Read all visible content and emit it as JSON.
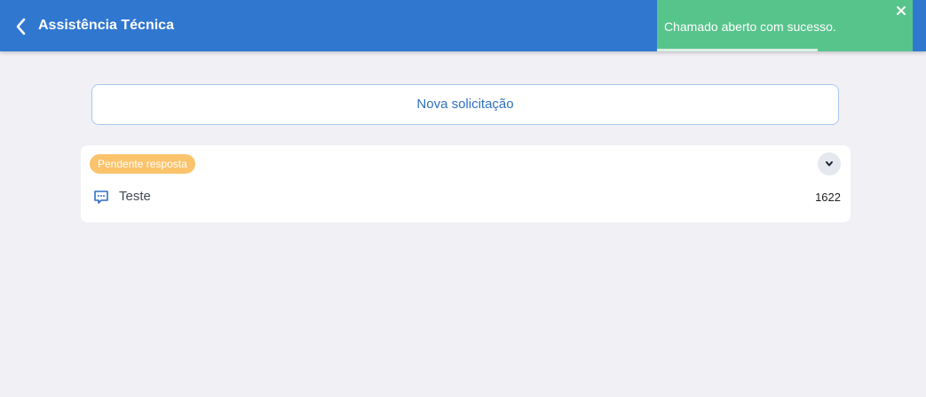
{
  "header": {
    "title": "Assistência Técnica"
  },
  "toast": {
    "message": "Chamado aberto com sucesso.",
    "progress": 0.63,
    "color": "#57c48c"
  },
  "main": {
    "new_request_label": "Nova solicitação"
  },
  "tickets": [
    {
      "status": "Pendente resposta",
      "subject": "Teste",
      "id": "1622",
      "status_color": "#fbc36c"
    }
  ],
  "colors": {
    "header_bg": "#3077d0",
    "page_bg": "#f1f0f5",
    "accent": "#2f6fc1"
  }
}
